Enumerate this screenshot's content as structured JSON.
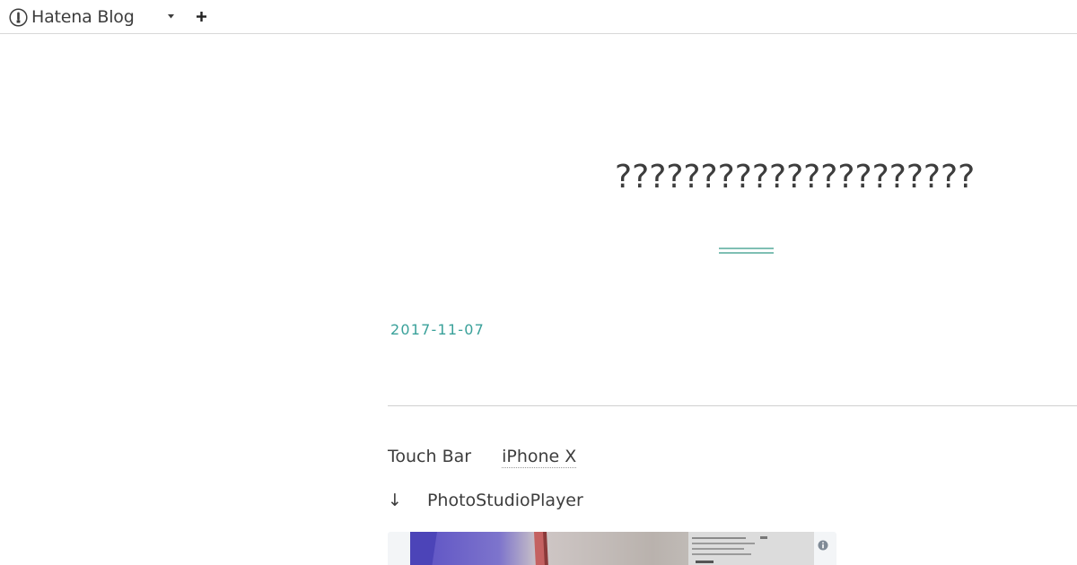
{
  "topbar": {
    "brand": "Hatena Blog",
    "dropdown_icon": "caret-down-icon",
    "add_icon": "plus-icon"
  },
  "blog": {
    "title": "?????????????????????",
    "title_color": "#3d3d3d",
    "accent_color": "#3aa19a"
  },
  "entry": {
    "date": "2017-11-07",
    "line1_text": "Touch Bar",
    "line1_link": "iPhone X",
    "line2_arrow": "↓",
    "line2_text": "PhotoStudioPlayer"
  },
  "embed": {
    "thumbnail_icon": "video-thumbnail",
    "info_icon": "info-icon"
  }
}
